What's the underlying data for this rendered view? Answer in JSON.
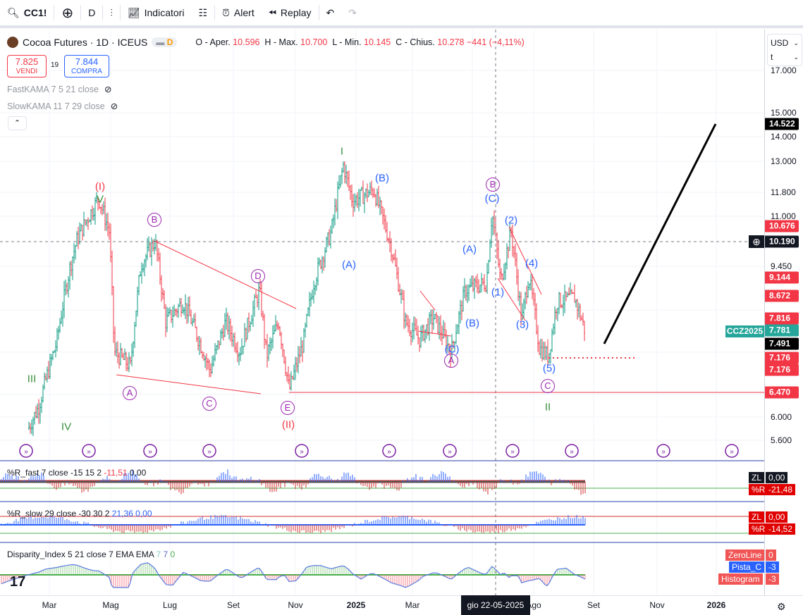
{
  "toolbar": {
    "symbol": "CC1!",
    "interval": "D",
    "indicators": "Indicatori",
    "alert": "Alert",
    "replay": "Replay"
  },
  "legend": {
    "title": "Cocoa Futures · 1D · ICEUS",
    "badge": "D",
    "o_label": "O - Aper.",
    "o": "10.596",
    "h_label": "H - Max.",
    "h": "10.700",
    "l_label": "L - Min.",
    "l": "10.145",
    "c_label": "C - Chius.",
    "c": "10.278",
    "change": "−441 (−4,11%)"
  },
  "trade": {
    "sell_price": "7.825",
    "sell_label": "VENDI",
    "spread": "19",
    "buy_price": "7.844",
    "buy_label": "COMPRA"
  },
  "studies": [
    {
      "label": "FastKAMA 7 5 21 close"
    },
    {
      "label": "SlowKAMA 11 7 29 close"
    }
  ],
  "axis": {
    "currency": "USD",
    "unit": "t",
    "ticks": [
      "17.000",
      "15.000",
      "14.000",
      "13.000",
      "11.800",
      "11.000",
      "9.450",
      "6.000",
      "5.600"
    ],
    "tags": [
      {
        "v": "14.522",
        "c": "#000000"
      },
      {
        "v": "10.676",
        "c": "#f23645"
      },
      {
        "v": "10.190",
        "c": "#131722"
      },
      {
        "v": "9.144",
        "c": "#f23645"
      },
      {
        "v": "8.672",
        "c": "#f23645"
      },
      {
        "v": "7.816",
        "c": "#f23645"
      },
      {
        "v": "7.781",
        "c": "#26a69a"
      },
      {
        "v": "7.491",
        "c": "#000000"
      },
      {
        "v": "7.176",
        "c": "#f23645"
      },
      {
        "v": "7.176",
        "c": "#f23645"
      },
      {
        "v": "6.470",
        "c": "#f23645"
      }
    ],
    "contract": "CCZ2025"
  },
  "waves": [
    "(I)",
    "V",
    "B",
    "A",
    "C",
    "D",
    "E",
    "(II)",
    "III",
    "IV",
    "I",
    "(B)",
    "(A)",
    "(C)",
    "A",
    "(B)",
    "(A)",
    "B",
    "(C)",
    "(2)",
    "(1)",
    "(4)",
    "(3)",
    "(5)",
    "C",
    "II"
  ],
  "panes": {
    "fast": {
      "title": "%R_fast 7 close -15 15 2",
      "v1": "-11,51",
      "v2": "0,00",
      "zl_label": "ZL",
      "zl": "0,00",
      "r_label": "%R",
      "r": "-21,48"
    },
    "slow": {
      "title": "%R_slow 29 close -30 30 2",
      "v1": "21,36",
      "v2": "0,00",
      "zl_label": "ZL",
      "zl": "0,00",
      "r_label": "%R",
      "r": "-14,52"
    },
    "disp": {
      "title": "Disparity_Index 5 21 close 7 EMA EMA",
      "v1": "7",
      "v2": "7",
      "v3": "0",
      "zero_label": "ZeroLine",
      "zero": "0",
      "pista_label": "Pista_C",
      "pista": "-3",
      "hist_label": "Histogram",
      "hist": "-3"
    }
  },
  "time": {
    "labels": [
      "Mar",
      "Mag",
      "Lug",
      "Set",
      "Nov",
      "2025",
      "Mar",
      "Ago",
      "Set",
      "Nov",
      "2026"
    ],
    "crosshair": "gio 22-05-2025"
  },
  "colors": {
    "up": "#089981",
    "down": "#f23645",
    "wave_blue": "#2962ff",
    "wave_purple": "#9c27b0",
    "wave_green": "#388e3c",
    "wave_red": "#f23645"
  }
}
